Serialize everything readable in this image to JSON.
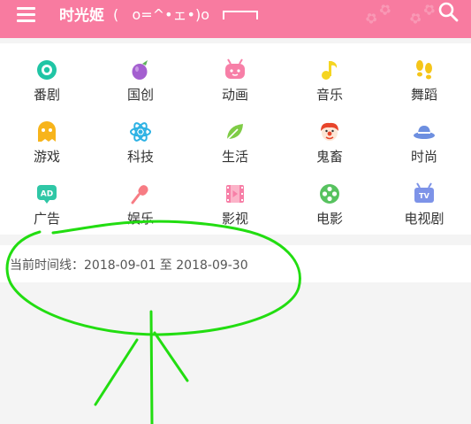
{
  "header": {
    "title": "时光姬",
    "kaomoji": "(   o=^•ェ•)o",
    "background": "#f87ba0"
  },
  "categories": [
    {
      "label": "番剧",
      "icon": "anime-disc-icon",
      "color": "#20c5a5"
    },
    {
      "label": "国创",
      "icon": "eggplant-icon",
      "color": "#a45fd0"
    },
    {
      "label": "动画",
      "icon": "tv-face-icon",
      "color": "#f77fa7"
    },
    {
      "label": "音乐",
      "icon": "music-note-icon",
      "color": "#f5d521"
    },
    {
      "label": "舞蹈",
      "icon": "footprints-icon",
      "color": "#f5c519"
    },
    {
      "label": "游戏",
      "icon": "ghost-icon",
      "color": "#f7b41b"
    },
    {
      "label": "科技",
      "icon": "atom-icon",
      "color": "#2db2e4"
    },
    {
      "label": "生活",
      "icon": "leaf-icon",
      "color": "#7fcc46"
    },
    {
      "label": "鬼畜",
      "icon": "clown-icon",
      "color": "#e8452b"
    },
    {
      "label": "时尚",
      "icon": "hat-icon",
      "color": "#6d8fe0"
    },
    {
      "label": "广告",
      "icon": "ad-badge-icon",
      "color": "#2fc7a6"
    },
    {
      "label": "娱乐",
      "icon": "microphone-icon",
      "color": "#f77c84"
    },
    {
      "label": "影视",
      "icon": "film-icon",
      "color": "#f77fa7"
    },
    {
      "label": "电影",
      "icon": "film-reel-icon",
      "color": "#57c25f"
    },
    {
      "label": "电视剧",
      "icon": "tv-icon",
      "color": "#7d93e8"
    }
  ],
  "timeline": {
    "text": "当前时间线：2018-09-01 至 2018-09-30"
  },
  "annotation_color": "#22dd11"
}
